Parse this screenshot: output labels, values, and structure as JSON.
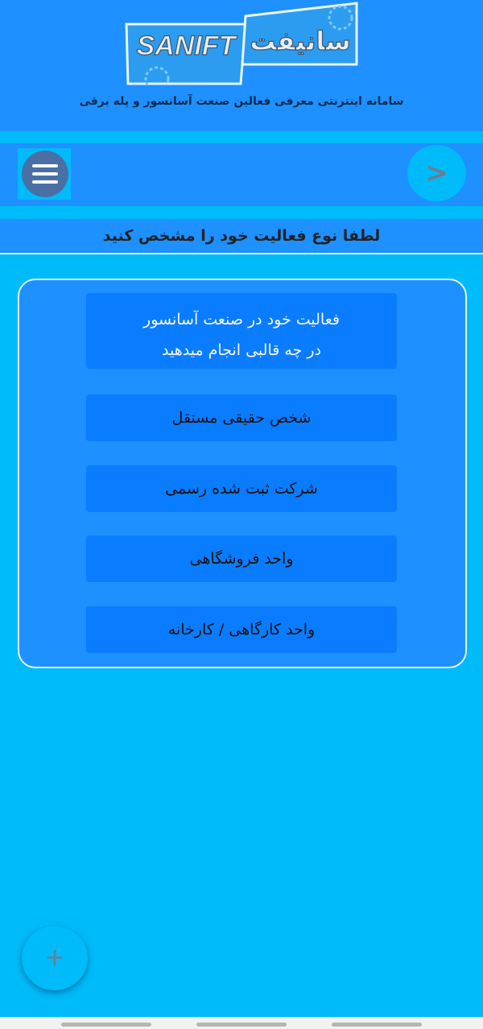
{
  "header": {
    "logo_latin": "SANIFT",
    "logo_persian": "سانیفت",
    "tagline": "سامانه اینترنتی معرفی فعالین صنعت آسانسور و پله برقی"
  },
  "toolbar": {
    "menu_icon": "hamburger-menu-icon",
    "next_label": ">"
  },
  "prompt": "لطفا نوع فعالیت خود را مشخص کنید",
  "card": {
    "question_line1": "فعالیت خود در صنعت آسانسور",
    "question_line2": "در چه قالبی انجام میدهید",
    "options": [
      {
        "label": "شخص حقیقی مستقل"
      },
      {
        "label": "شرکت ثبت شده رسمی"
      },
      {
        "label": "واحد فروشگاهی"
      },
      {
        "label": "واحد کارگاهی / کارخانه"
      }
    ]
  },
  "fab": {
    "label": "+",
    "icon": "plus-icon"
  },
  "colors": {
    "header": "#1e90ff",
    "background": "#00bbf9",
    "option": "#0a7cff"
  }
}
